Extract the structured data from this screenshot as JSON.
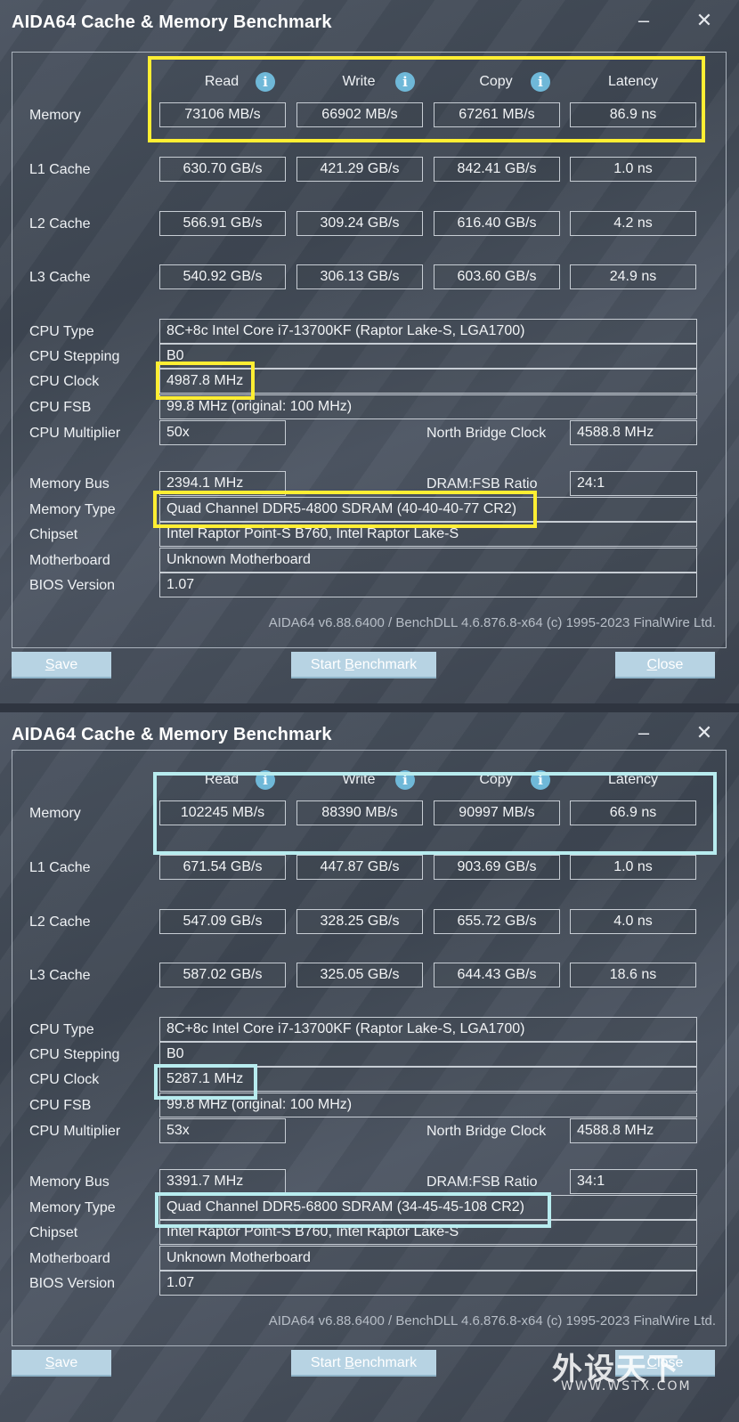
{
  "windows": [
    {
      "title": "AIDA64 Cache & Memory Benchmark",
      "minimize": "–",
      "close_glyph": "✕",
      "headers": {
        "read": "Read",
        "write": "Write",
        "copy": "Copy",
        "latency": "Latency"
      },
      "info_glyph": "i",
      "rows": [
        {
          "label": "Memory",
          "read": "73106 MB/s",
          "write": "66902 MB/s",
          "copy": "67261 MB/s",
          "latency": "86.9 ns"
        },
        {
          "label": "L1 Cache",
          "read": "630.70 GB/s",
          "write": "421.29 GB/s",
          "copy": "842.41 GB/s",
          "latency": "1.0 ns"
        },
        {
          "label": "L2 Cache",
          "read": "566.91 GB/s",
          "write": "309.24 GB/s",
          "copy": "616.40 GB/s",
          "latency": "4.2 ns"
        },
        {
          "label": "L3 Cache",
          "read": "540.92 GB/s",
          "write": "306.13 GB/s",
          "copy": "603.60 GB/s",
          "latency": "24.9 ns"
        }
      ],
      "cpu_type_label": "CPU Type",
      "cpu_type": "8C+8c Intel Core i7-13700KF  (Raptor Lake-S, LGA1700)",
      "cpu_stepping_label": "CPU Stepping",
      "cpu_stepping": "B0",
      "cpu_clock_label": "CPU Clock",
      "cpu_clock": "4987.8 MHz",
      "cpu_fsb_label": "CPU FSB",
      "cpu_fsb": "99.8 MHz  (original: 100 MHz)",
      "cpu_mult_label": "CPU Multiplier",
      "cpu_mult": "50x",
      "nb_clock_label": "North Bridge Clock",
      "nb_clock": "4588.8 MHz",
      "mem_bus_label": "Memory Bus",
      "mem_bus": "2394.1 MHz",
      "dram_ratio_label": "DRAM:FSB Ratio",
      "dram_ratio": "24:1",
      "mem_type_label": "Memory Type",
      "mem_type": "Quad Channel DDR5-4800 SDRAM  (40-40-40-77 CR2)",
      "chipset_label": "Chipset",
      "chipset": "Intel Raptor Point-S B760, Intel Raptor Lake-S",
      "mobo_label": "Motherboard",
      "mobo": "Unknown Motherboard",
      "bios_label": "BIOS Version",
      "bios": "1.07",
      "footer": "AIDA64 v6.88.6400 / BenchDLL 4.6.876.8-x64  (c) 1995-2023 FinalWire Ltd.",
      "save_btn": {
        "pre": "",
        "u": "S",
        "post": "ave"
      },
      "start_btn": {
        "pre": "Start ",
        "u": "B",
        "post": "enchmark"
      },
      "close_btn": {
        "pre": "",
        "u": "C",
        "post": "lose"
      },
      "highlight_color": "#ffee33"
    },
    {
      "title": "AIDA64 Cache & Memory Benchmark",
      "minimize": "–",
      "close_glyph": "✕",
      "headers": {
        "read": "Read",
        "write": "Write",
        "copy": "Copy",
        "latency": "Latency"
      },
      "info_glyph": "i",
      "rows": [
        {
          "label": "Memory",
          "read": "102245 MB/s",
          "write": "88390 MB/s",
          "copy": "90997 MB/s",
          "latency": "66.9 ns"
        },
        {
          "label": "L1 Cache",
          "read": "671.54 GB/s",
          "write": "447.87 GB/s",
          "copy": "903.69 GB/s",
          "latency": "1.0 ns"
        },
        {
          "label": "L2 Cache",
          "read": "547.09 GB/s",
          "write": "328.25 GB/s",
          "copy": "655.72 GB/s",
          "latency": "4.0 ns"
        },
        {
          "label": "L3 Cache",
          "read": "587.02 GB/s",
          "write": "325.05 GB/s",
          "copy": "644.43 GB/s",
          "latency": "18.6 ns"
        }
      ],
      "cpu_type_label": "CPU Type",
      "cpu_type": "8C+8c Intel Core i7-13700KF  (Raptor Lake-S, LGA1700)",
      "cpu_stepping_label": "CPU Stepping",
      "cpu_stepping": "B0",
      "cpu_clock_label": "CPU Clock",
      "cpu_clock": "5287.1 MHz",
      "cpu_fsb_label": "CPU FSB",
      "cpu_fsb": "99.8 MHz  (original: 100 MHz)",
      "cpu_mult_label": "CPU Multiplier",
      "cpu_mult": "53x",
      "nb_clock_label": "North Bridge Clock",
      "nb_clock": "4588.8 MHz",
      "mem_bus_label": "Memory Bus",
      "mem_bus": "3391.7 MHz",
      "dram_ratio_label": "DRAM:FSB Ratio",
      "dram_ratio": "34:1",
      "mem_type_label": "Memory Type",
      "mem_type": "Quad Channel DDR5-6800 SDRAM  (34-45-45-108 CR2)",
      "chipset_label": "Chipset",
      "chipset": "Intel Raptor Point-S B760, Intel Raptor Lake-S",
      "mobo_label": "Motherboard",
      "mobo": "Unknown Motherboard",
      "bios_label": "BIOS Version",
      "bios": "1.07",
      "footer": "AIDA64 v6.88.6400 / BenchDLL 4.6.876.8-x64  (c) 1995-2023 FinalWire Ltd.",
      "save_btn": {
        "pre": "",
        "u": "S",
        "post": "ave"
      },
      "start_btn": {
        "pre": "Start ",
        "u": "B",
        "post": "enchmark"
      },
      "close_btn": {
        "pre": "",
        "u": "C",
        "post": "lose"
      },
      "highlight_color": "#b8ecef"
    }
  ],
  "watermark": {
    "text": "外设天下",
    "sub": "WWW.WSTX.COM"
  }
}
